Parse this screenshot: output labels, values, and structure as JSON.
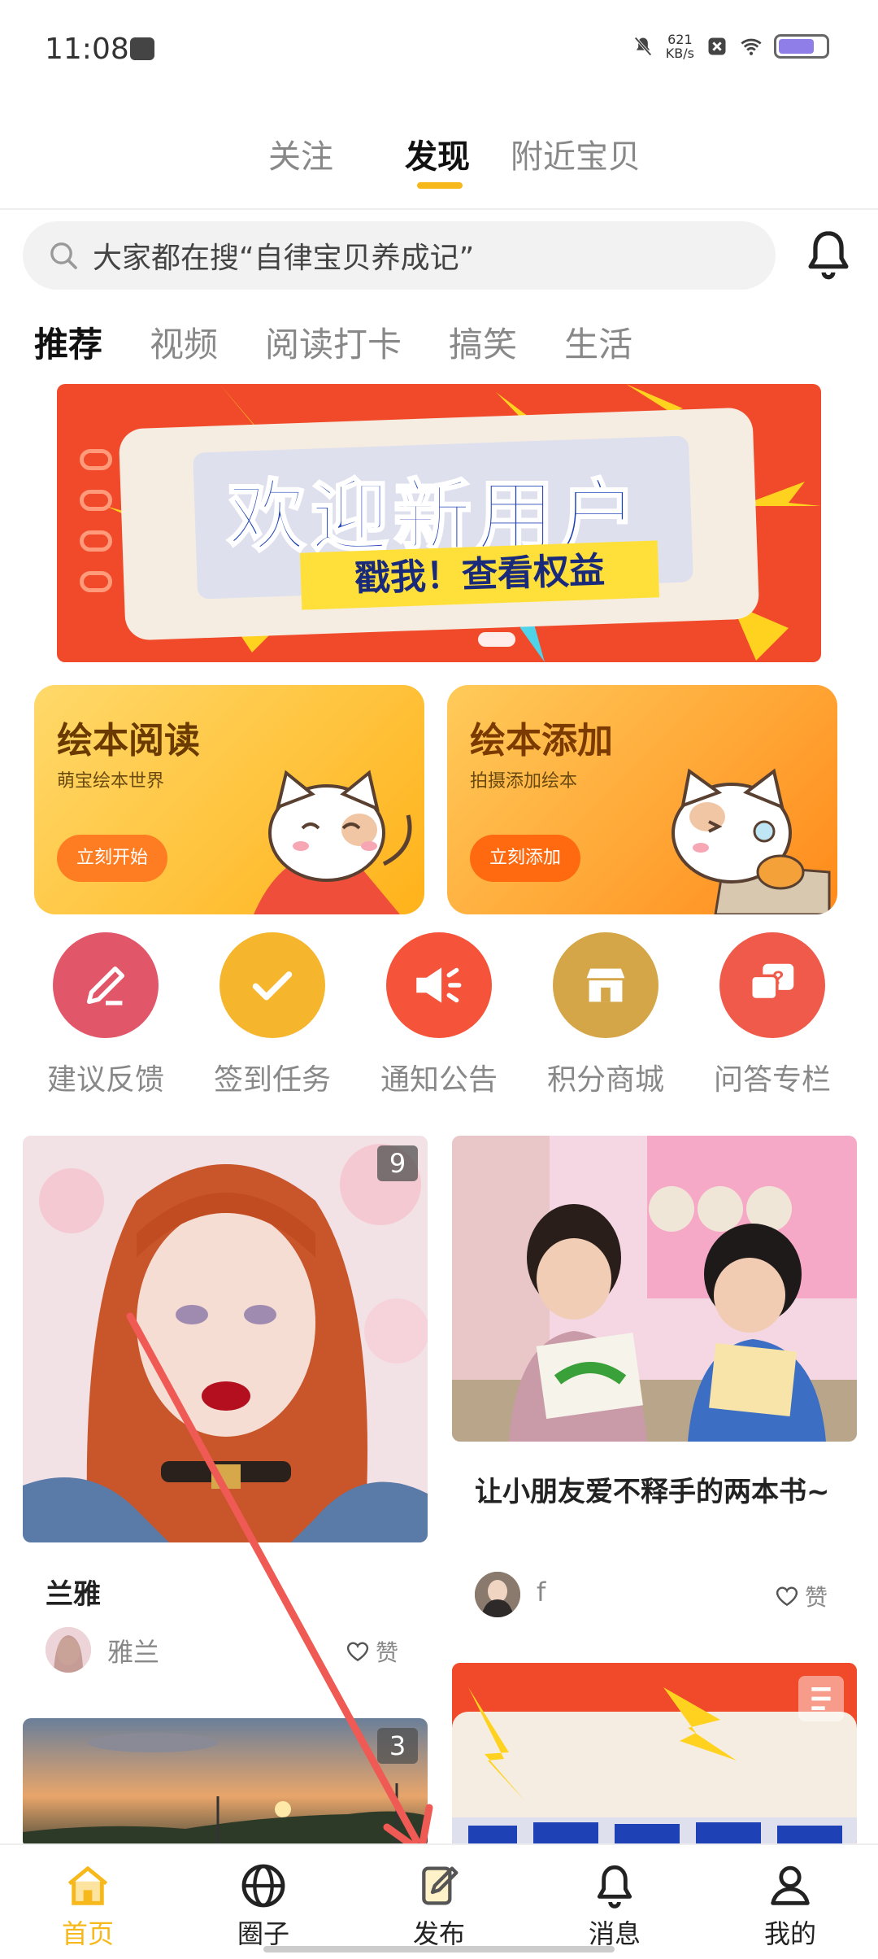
{
  "status": {
    "time": "11:08",
    "speed_value": "621",
    "speed_unit": "KB/s"
  },
  "top_tabs": [
    {
      "label": "关注",
      "active": false
    },
    {
      "label": "发现",
      "active": true
    },
    {
      "label": "附近宝贝",
      "active": false
    }
  ],
  "search": {
    "placeholder": "大家都在搜“自律宝贝养成记”"
  },
  "categories": [
    {
      "label": "推荐",
      "active": true
    },
    {
      "label": "视频",
      "active": false
    },
    {
      "label": "阅读打卡",
      "active": false
    },
    {
      "label": "搞笑",
      "active": false
    },
    {
      "label": "生活",
      "active": false
    }
  ],
  "banner": {
    "title": "欢迎新用户",
    "subtitle": "戳我！查看权益"
  },
  "feature_cards": {
    "reading": {
      "title": "绘本阅读",
      "subtitle": "萌宝绘本世界",
      "button": "立刻开始"
    },
    "adding": {
      "title": "绘本添加",
      "subtitle": "拍摄添加绘本",
      "button": "立刻添加"
    }
  },
  "quick_links": [
    {
      "label": "建议反馈",
      "color": "#e2566a",
      "icon": "pencil-icon"
    },
    {
      "label": "签到任务",
      "color": "#f5b62e",
      "icon": "check-icon"
    },
    {
      "label": "通知公告",
      "color": "#f5533a",
      "icon": "megaphone-icon"
    },
    {
      "label": "积分商城",
      "color": "#d4a648",
      "icon": "store-icon"
    },
    {
      "label": "问答专栏",
      "color": "#f05a4a",
      "icon": "question-icon"
    }
  ],
  "posts": {
    "left1": {
      "image_count": "9",
      "title": "兰雅",
      "author": "雅兰",
      "like": "赞"
    },
    "right1": {
      "title": "让小朋友爱不释手的两本书~",
      "author": "f",
      "like": "赞"
    },
    "left2": {
      "image_count": "3"
    }
  },
  "tabbar": [
    {
      "label": "首页",
      "active": true
    },
    {
      "label": "圈子",
      "active": false
    },
    {
      "label": "发布",
      "active": false
    },
    {
      "label": "消息",
      "active": false
    },
    {
      "label": "我的",
      "active": false
    }
  ],
  "colors": {
    "accent": "#f6b81a",
    "annotation_arrow": "#ef5a55"
  }
}
